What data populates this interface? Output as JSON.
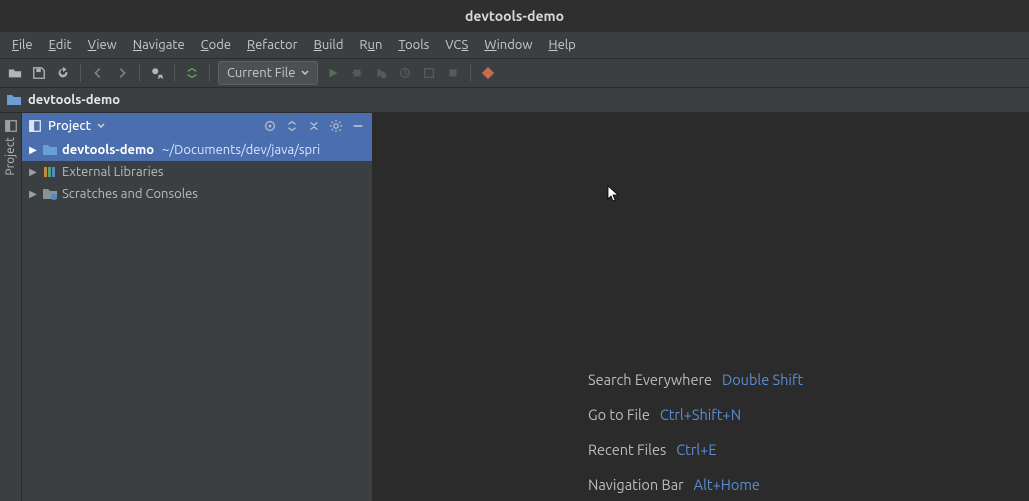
{
  "window": {
    "title": "devtools-demo"
  },
  "menubar": {
    "items": [
      {
        "label": "File",
        "mnemonic": "F"
      },
      {
        "label": "Edit",
        "mnemonic": "E"
      },
      {
        "label": "View",
        "mnemonic": "V"
      },
      {
        "label": "Navigate",
        "mnemonic": "N"
      },
      {
        "label": "Code",
        "mnemonic": "C"
      },
      {
        "label": "Refactor",
        "mnemonic": "R"
      },
      {
        "label": "Build",
        "mnemonic": "B"
      },
      {
        "label": "Run",
        "mnemonic": "R"
      },
      {
        "label": "Tools",
        "mnemonic": "T"
      },
      {
        "label": "VCS",
        "mnemonic": "S"
      },
      {
        "label": "Window",
        "mnemonic": "W"
      },
      {
        "label": "Help",
        "mnemonic": "H"
      }
    ]
  },
  "toolbar": {
    "run_config_label": "Current File"
  },
  "navbar": {
    "project_name": "devtools-demo"
  },
  "gutter": {
    "project_tab": "Project"
  },
  "project_panel": {
    "title": "Project",
    "nodes": {
      "root": {
        "name": "devtools-demo",
        "path": "~/Documents/dev/java/spri"
      },
      "ext_libs": {
        "name": "External Libraries"
      },
      "scratches": {
        "name": "Scratches and Consoles"
      }
    }
  },
  "editor_hints": {
    "items": [
      {
        "label": "Search Everywhere",
        "key": "Double Shift"
      },
      {
        "label": "Go to File",
        "key": "Ctrl+Shift+N"
      },
      {
        "label": "Recent Files",
        "key": "Ctrl+E"
      },
      {
        "label": "Navigation Bar",
        "key": "Alt+Home"
      }
    ]
  }
}
